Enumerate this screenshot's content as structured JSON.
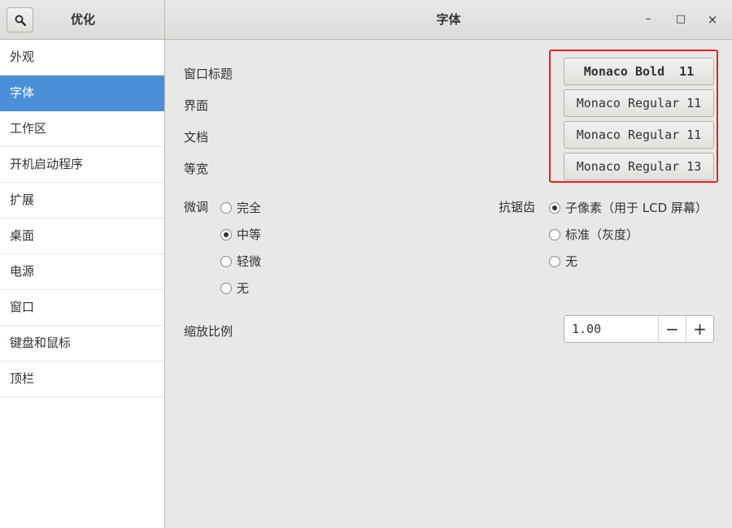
{
  "header": {
    "sidebar_title": "优化",
    "title": "字体",
    "minimize": "–",
    "maximize": "□",
    "close": "×"
  },
  "sidebar": {
    "items": [
      {
        "label": "外观"
      },
      {
        "label": "字体",
        "active": true
      },
      {
        "label": "工作区"
      },
      {
        "label": "开机启动程序"
      },
      {
        "label": "扩展"
      },
      {
        "label": "桌面"
      },
      {
        "label": "电源"
      },
      {
        "label": "窗口"
      },
      {
        "label": "键盘和鼠标"
      },
      {
        "label": "顶栏"
      }
    ]
  },
  "fonts": {
    "window_title": {
      "label": "窗口标题",
      "value": "Monaco Bold  11"
    },
    "interface": {
      "label": "界面",
      "value": "Monaco Regular 11"
    },
    "document": {
      "label": "文档",
      "value": "Monaco Regular 11"
    },
    "monospace": {
      "label": "等宽",
      "value": "Monaco Regular 13"
    }
  },
  "hinting": {
    "label": "微调",
    "options": [
      "完全",
      "中等",
      "轻微",
      "无"
    ],
    "selected": "中等"
  },
  "antialiasing": {
    "label": "抗锯齿",
    "options": [
      "子像素（用于 LCD 屏幕）",
      "标准（灰度）",
      "无"
    ],
    "selected": "子像素（用于 LCD 屏幕）"
  },
  "scaling": {
    "label": "缩放比例",
    "value": "1.00",
    "decrement": "−",
    "increment": "+"
  },
  "colors": {
    "accent": "#4a90d9",
    "highlight_border": "#e02020"
  }
}
